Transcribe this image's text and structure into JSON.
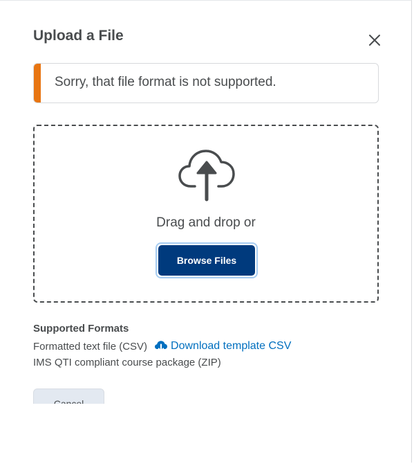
{
  "dialog": {
    "title": "Upload a File",
    "close_icon": "close-icon"
  },
  "alert": {
    "message": "Sorry, that file format is not supported.",
    "accent_color": "#e87511"
  },
  "dropzone": {
    "icon": "cloud-upload-icon",
    "instruction": "Drag and drop or",
    "browse_label": "Browse Files",
    "browse_color": "#003a7d"
  },
  "formats": {
    "heading": "Supported Formats",
    "items": [
      {
        "label": "Formatted text file (CSV)",
        "link_icon": "cloud-download-icon",
        "link_label": "Download template CSV"
      },
      {
        "label": "IMS QTI compliant course package (ZIP)"
      }
    ],
    "link_color": "#006fbf"
  },
  "footer": {
    "cancel_label": "Cancel"
  }
}
